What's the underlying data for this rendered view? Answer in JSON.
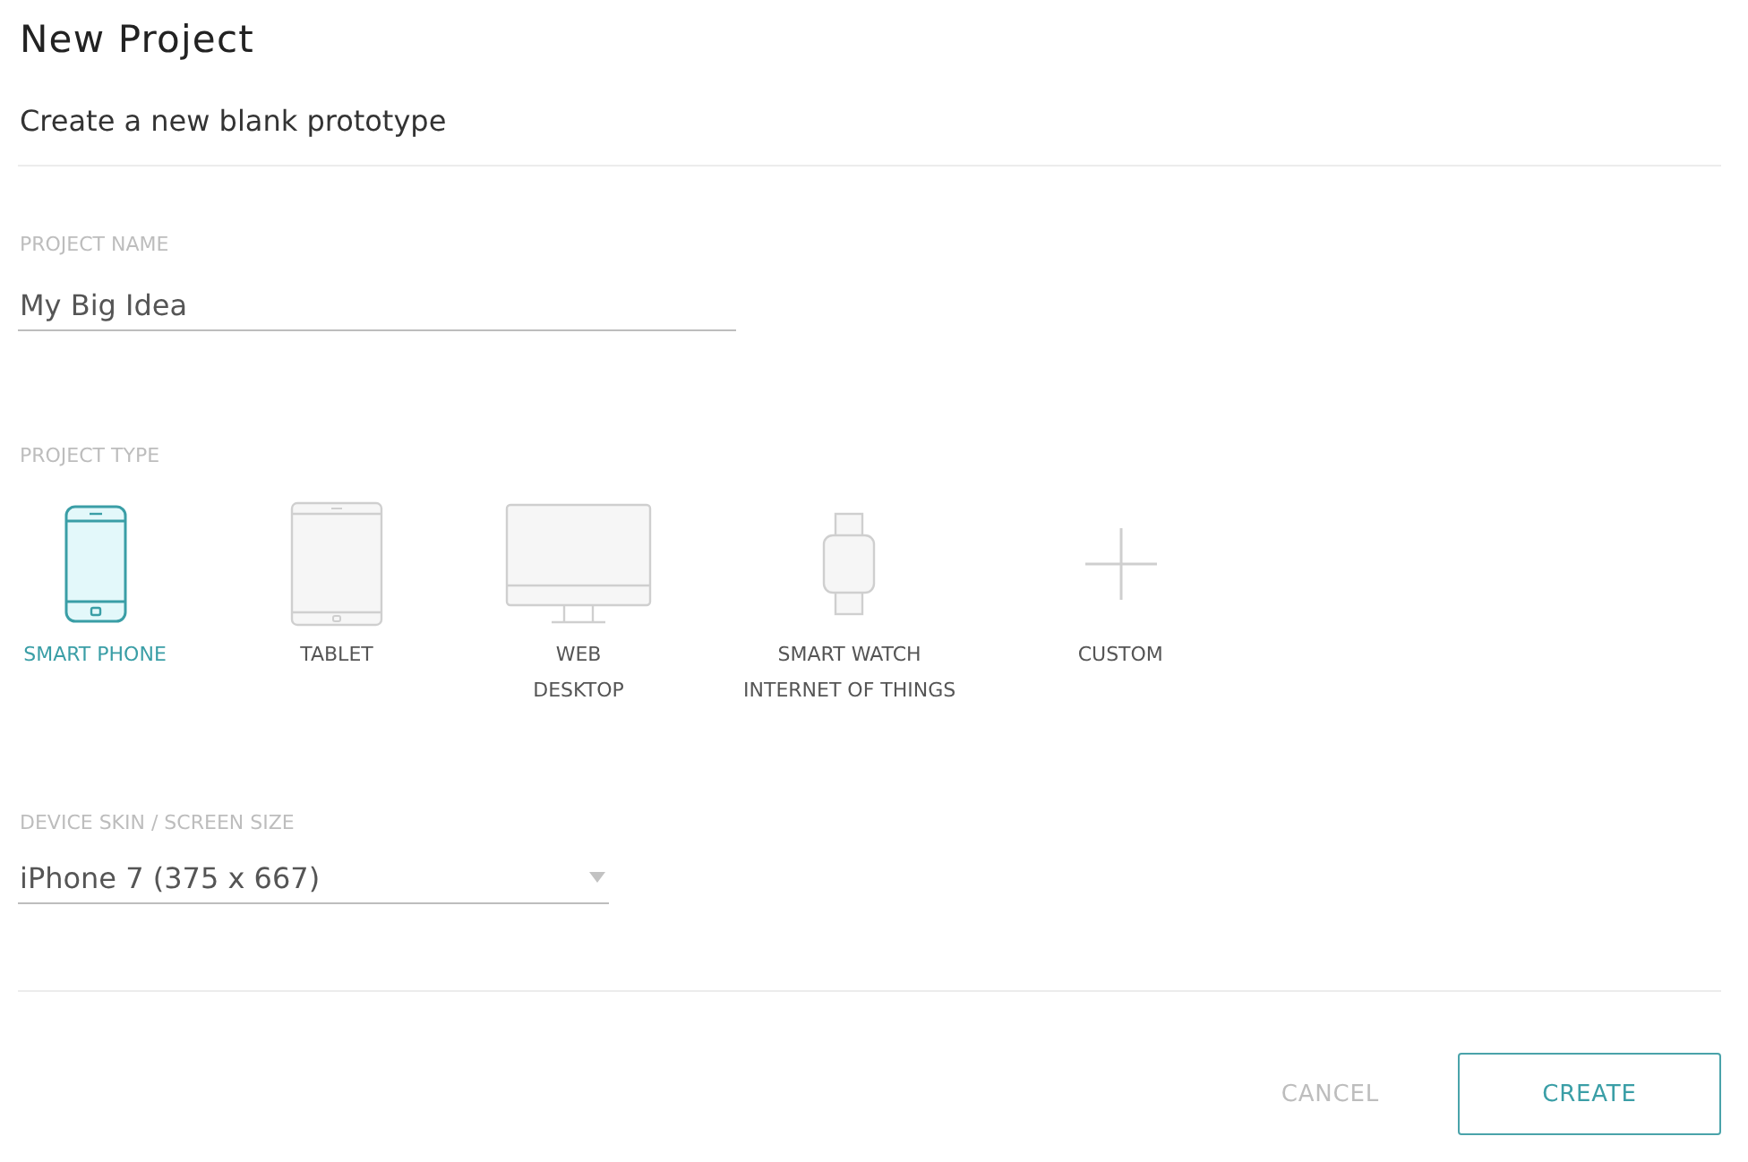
{
  "dialog": {
    "title": "New Project",
    "subtitle": "Create a new blank prototype"
  },
  "project_name": {
    "label": "PROJECT NAME",
    "value": "My Big Idea"
  },
  "project_type": {
    "label": "PROJECT TYPE",
    "options": [
      {
        "kind": "phone",
        "lines": [
          "SMART PHONE"
        ],
        "selected": true
      },
      {
        "kind": "tablet",
        "lines": [
          "TABLET"
        ],
        "selected": false
      },
      {
        "kind": "desktop",
        "lines": [
          "WEB",
          "DESKTOP"
        ],
        "selected": false
      },
      {
        "kind": "watch",
        "lines": [
          "SMART WATCH",
          "INTERNET OF THINGS"
        ],
        "selected": false
      },
      {
        "kind": "custom",
        "lines": [
          "CUSTOM"
        ],
        "selected": false
      }
    ]
  },
  "device_skin": {
    "label": "DEVICE SKIN / SCREEN SIZE",
    "value": "iPhone 7 (375 x 667)"
  },
  "buttons": [
    {
      "kind": "text",
      "label": "CANCEL"
    },
    {
      "kind": "outlined",
      "label": "CREATE"
    }
  ]
}
